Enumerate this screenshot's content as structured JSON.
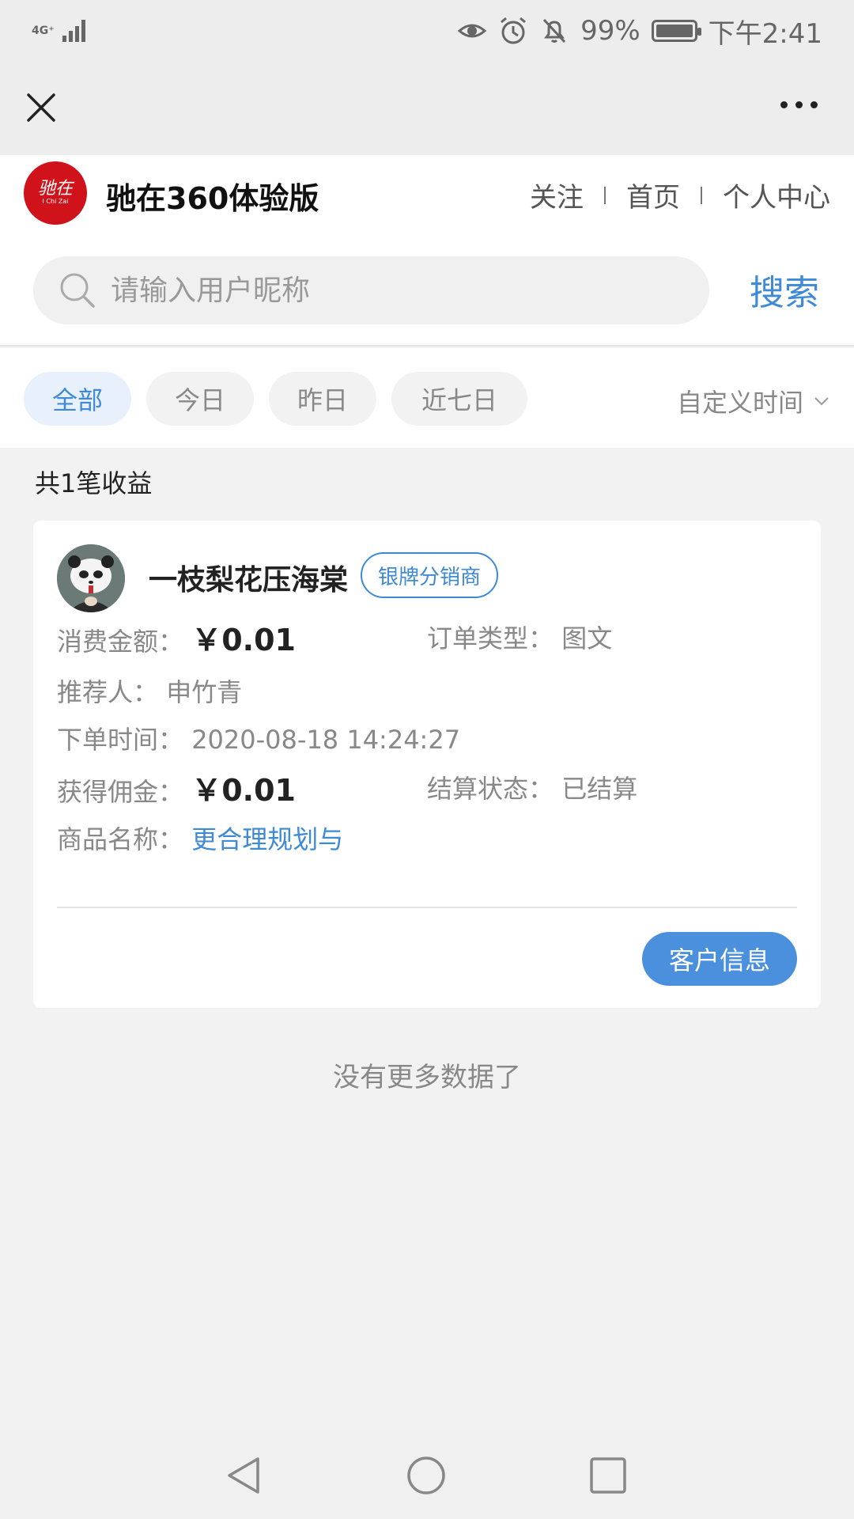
{
  "status_bar": {
    "network": "4G⁺",
    "battery": "99%",
    "time": "下午2:41"
  },
  "brand": {
    "title": "驰在360体验版",
    "logo_text": "驰在",
    "logo_sub": "I Chi Zai",
    "links": [
      "关注",
      "首页",
      "个人中心"
    ]
  },
  "search": {
    "placeholder": "请输入用户昵称",
    "button": "搜索"
  },
  "filters": {
    "chips": [
      "全部",
      "今日",
      "昨日",
      "近七日"
    ],
    "active": "全部",
    "custom_time": "自定义时间"
  },
  "summary": "共1笔收益",
  "order": {
    "user_name": "一枝梨花压海棠",
    "badge": "银牌分销商",
    "amount_label": "消费金额：",
    "amount": "￥0.01",
    "type_label": "订单类型：",
    "type": "图文",
    "referrer_label": "推荐人：",
    "referrer": "申竹青",
    "time_label": "下单时间：",
    "time": "2020-08-18 14:24:27",
    "commission_label": "获得佣金：",
    "commission": "￥0.01",
    "settle_label": "结算状态：",
    "settle": "已结算",
    "product_label": "商品名称：",
    "product": "更合理规划与",
    "customer_button": "客户信息"
  },
  "no_more": "没有更多数据了"
}
